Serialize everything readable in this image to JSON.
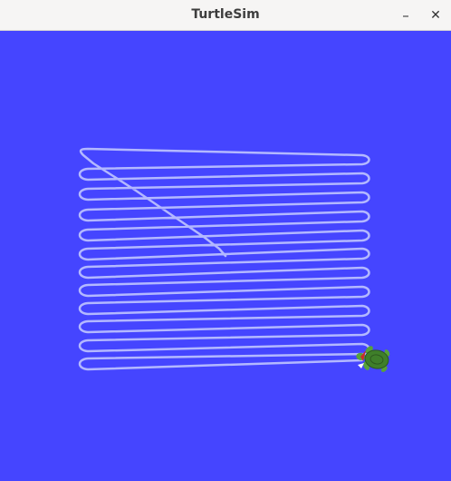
{
  "window": {
    "title": "TurtleSim",
    "minimize_glyph": "–",
    "close_glyph": "✕"
  },
  "colors": {
    "background": "#4545ff",
    "pen": "#b3b8ff",
    "turtle_shell": "#3f7f2a",
    "turtle_skin": "#57a33a"
  },
  "icons": {
    "turtle": "turtle-icon"
  }
}
